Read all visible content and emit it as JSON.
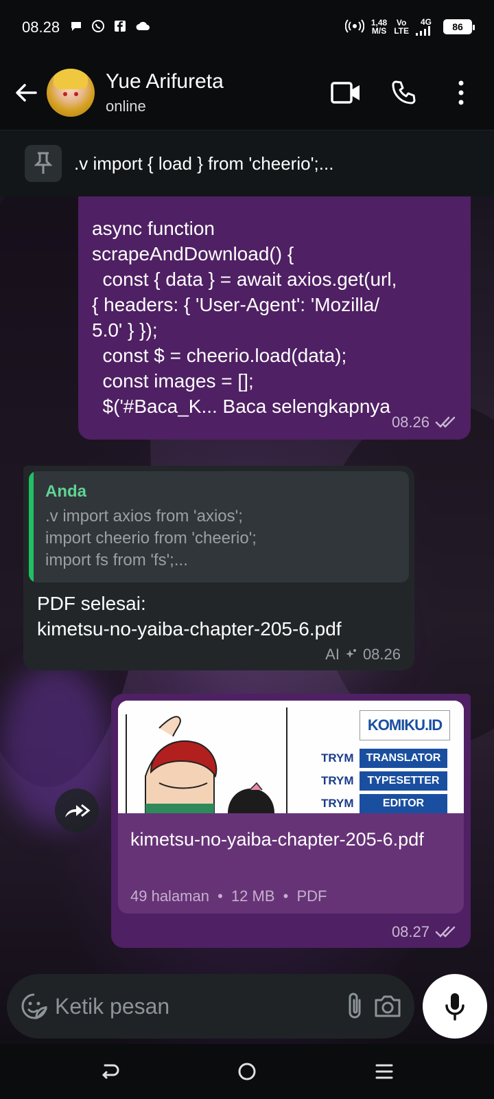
{
  "status_bar": {
    "time": "08.28",
    "net_speed_value": "1,48",
    "net_speed_unit": "M/S",
    "volte_top": "Vo",
    "volte_bottom": "LTE",
    "network": "4G",
    "battery": "86"
  },
  "header": {
    "contact_name": "Yue Arifureta",
    "contact_status": "online"
  },
  "pinned": {
    "text": ".v import { load } from 'cheerio';..."
  },
  "messages": {
    "code": {
      "text": "async function\nscrapeAndDownload() {\n  const { data } = await axios.get(url,\n{ headers: { 'User-Agent': 'Mozilla/\n5.0' } });\n  const $ = cheerio.load(data);\n  const images = [];\n  $('#Baca_K... Baca selengkapnya",
      "time": "08.26"
    },
    "reply": {
      "quote_author": "Anda",
      "quote_text": ".v import axios from 'axios';\nimport cheerio from 'cheerio';\nimport fs from 'fs';...",
      "text": "PDF selesai:\nkimetsu-no-yaiba-chapter-205-6.pdf",
      "ai_label": "AI",
      "time": "08.26"
    },
    "file": {
      "file_name": "kimetsu-no-yaiba-chapter-205-6.pdf",
      "pages": "49 halaman",
      "size": "12 MB",
      "type": "PDF",
      "separator": "•",
      "time": "08.27",
      "preview": {
        "logo": "KOMIKU.ID",
        "credits": [
          {
            "name": "TRYM",
            "role": "TRANSLATOR"
          },
          {
            "name": "TRYM",
            "role": "TYPESETTER"
          },
          {
            "name": "TRYM",
            "role": "EDITOR"
          }
        ]
      }
    }
  },
  "composer": {
    "placeholder": "Ketik pesan"
  },
  "colors": {
    "outgoing_bubble": "#4f2063",
    "incoming_bubble": "#222629",
    "accent_green": "#21c063"
  }
}
